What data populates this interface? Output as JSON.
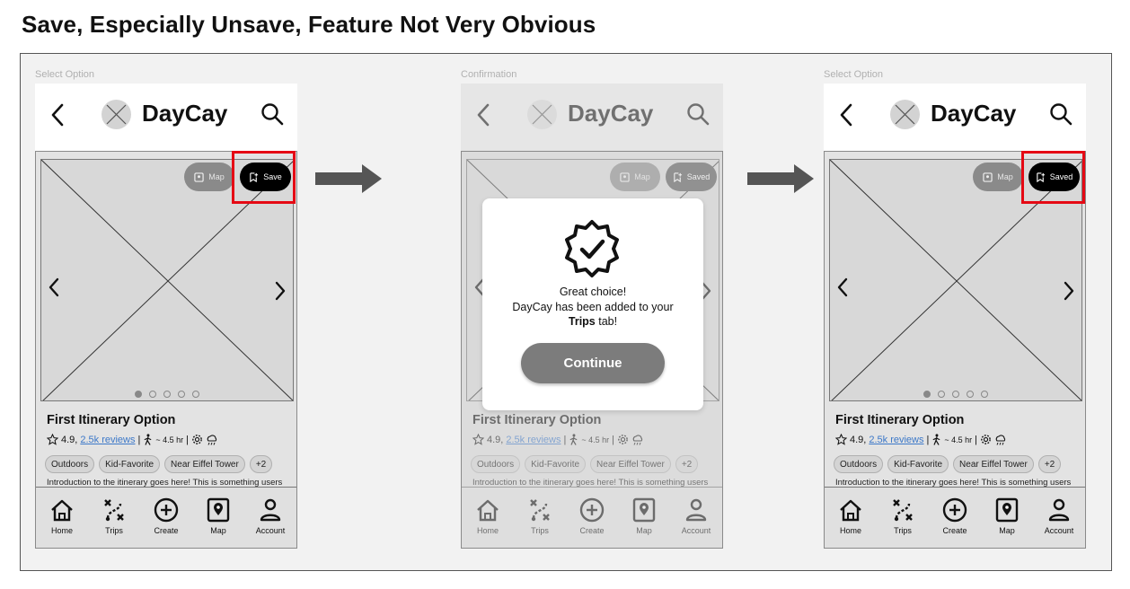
{
  "page_title": "Save, Especially Unsave, Feature Not Very Obvious",
  "frames": [
    {
      "label": "Select Option",
      "state": "unsaved"
    },
    {
      "label": "Confirmation",
      "state": "confirmation"
    },
    {
      "label": "Select Option",
      "state": "saved"
    }
  ],
  "app": {
    "name": "DayCay",
    "map_label": "Map",
    "save_label": "Save",
    "saved_label": "Saved"
  },
  "card": {
    "title": "First Itinerary Option",
    "rating": "4.9,",
    "reviews": "2.5k reviews",
    "separator": "|",
    "duration": "~ 4.5 hr",
    "tags": [
      "Outdoors",
      "Kid-Favorite",
      "Near Eiffel Tower",
      "+2"
    ],
    "intro": "Introduction to the itinerary goes here! This is something users"
  },
  "carousel": {
    "total": 5,
    "active": 1
  },
  "tabs": [
    {
      "label": "Home",
      "icon": "home-icon"
    },
    {
      "label": "Trips",
      "icon": "trips-icon"
    },
    {
      "label": "Create",
      "icon": "create-icon"
    },
    {
      "label": "Map",
      "icon": "map-icon"
    },
    {
      "label": "Account",
      "icon": "account-icon"
    }
  ],
  "modal": {
    "line1": "Great choice!",
    "line2": "DayCay has been added to your",
    "line3_bold": "Trips",
    "line3_rest": " tab!",
    "button": "Continue"
  },
  "colors": {
    "highlight": "#e50914",
    "link": "#3c78c8",
    "save_pill": "#000000",
    "map_pill": "#8a8a8a",
    "continue_button": "#7c7c7c"
  }
}
